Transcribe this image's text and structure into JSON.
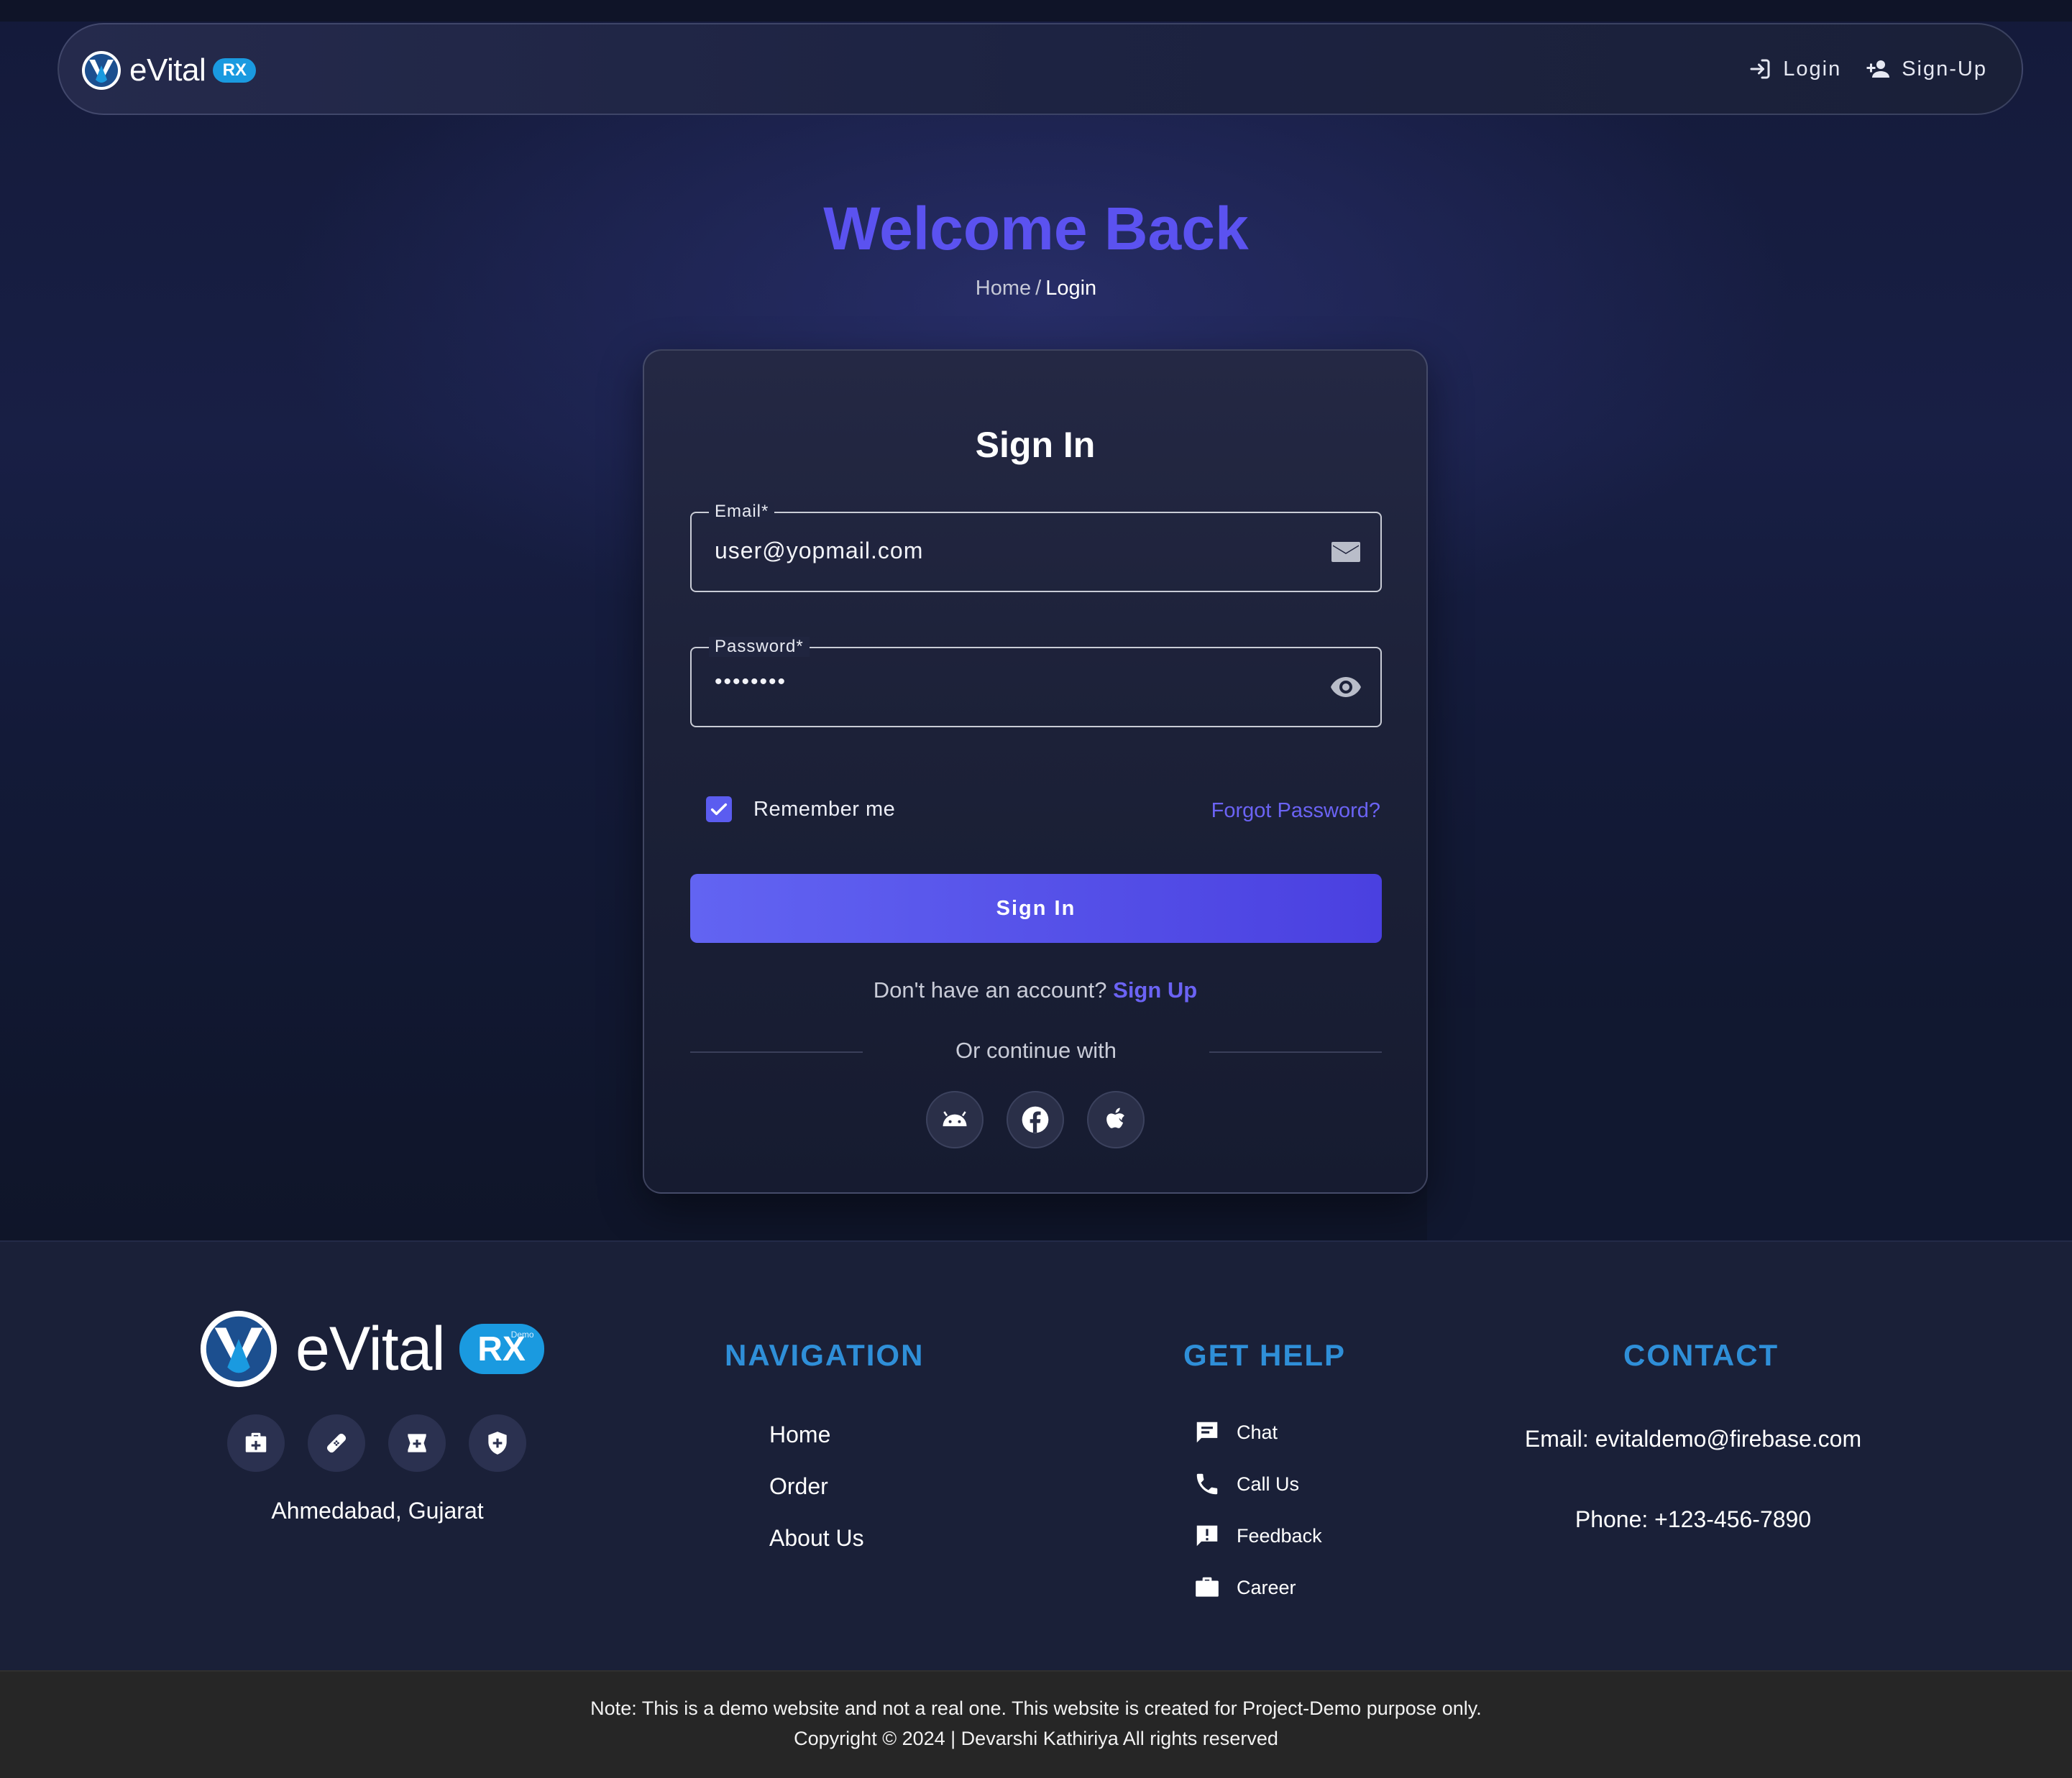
{
  "header": {
    "logo_text": "eVital",
    "logo_badge": "RX",
    "login_label": "Login",
    "signup_label": "Sign-Up"
  },
  "page": {
    "title": "Welcome Back",
    "breadcrumb": {
      "home": "Home",
      "separator": "/",
      "current": "Login"
    }
  },
  "form": {
    "title": "Sign In",
    "email": {
      "label": "Email*",
      "value": "user@yopmail.com"
    },
    "password": {
      "label": "Password*",
      "value": "••••••••"
    },
    "remember_label": "Remember me",
    "remember_checked": true,
    "forgot_label": "Forgot Password?",
    "submit_label": "Sign In",
    "no_account_text": "Don't have an account?",
    "signup_link": "Sign Up",
    "divider_text": "Or continue with",
    "social": [
      "android-icon",
      "facebook-icon",
      "apple-icon"
    ]
  },
  "footer": {
    "logo_text": "eVital",
    "logo_badge": "RX",
    "logo_badge_sub": "Demo",
    "icons": [
      "first-aid-kit-icon",
      "bandage-icon",
      "pharmacy-icon",
      "health-shield-icon"
    ],
    "city": "Ahmedabad, Gujarat",
    "navigation": {
      "title": "NAVIGATION",
      "items": [
        "Home",
        "Order",
        "About Us"
      ]
    },
    "help": {
      "title": "GET HELP",
      "items": [
        {
          "label": "Chat",
          "icon": "chat-icon"
        },
        {
          "label": "Call Us",
          "icon": "phone-icon"
        },
        {
          "label": "Feedback",
          "icon": "feedback-icon"
        },
        {
          "label": "Career",
          "icon": "briefcase-icon"
        }
      ]
    },
    "contact": {
      "title": "CONTACT",
      "email": "Email: evitaldemo@firebase.com",
      "phone": "Phone: +123-456-7890"
    },
    "note": "Note: This is a demo website and not a real one. This website is created for Project-Demo purpose only.",
    "copyright": "Copyright © 2024 | Devarshi Kathiriya All rights reserved"
  },
  "colors": {
    "accent": "#5b52f0",
    "link": "#6b63f4",
    "footer_heading": "#2f8fd8",
    "badge": "#1a9ae0"
  }
}
